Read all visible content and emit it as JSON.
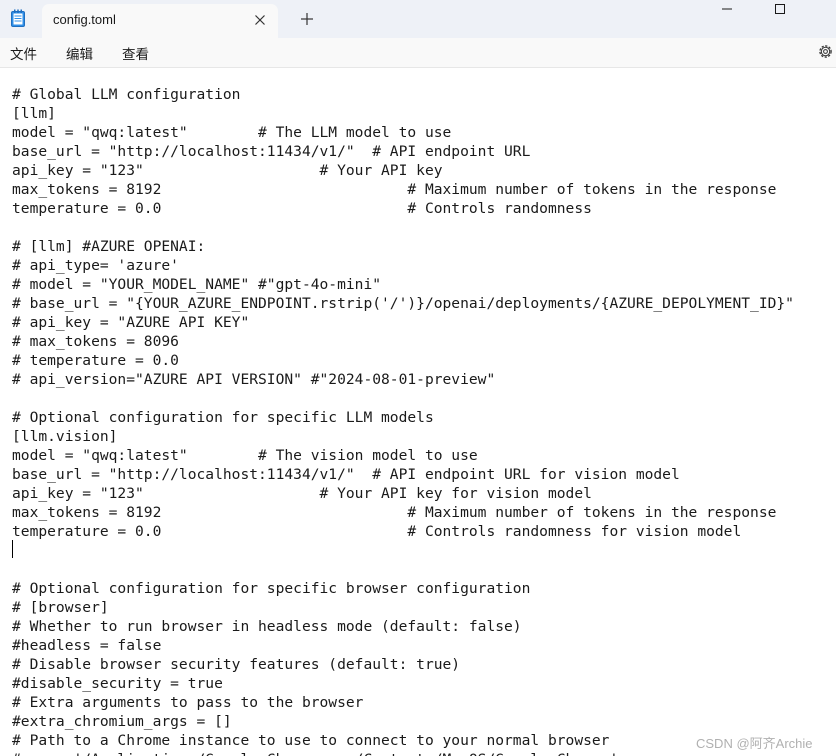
{
  "window": {
    "tab_title": "config.toml"
  },
  "menu": {
    "file": "文件",
    "edit": "编辑",
    "view": "查看"
  },
  "icons": {
    "app": "notepad-icon",
    "close_tab": "close-icon",
    "new_tab": "plus-icon",
    "minimize": "minimize-icon",
    "maximize": "maximize-icon",
    "settings": "gear-icon"
  },
  "editor": {
    "lines": [
      "# Global LLM configuration",
      "[llm]",
      "model = \"qwq:latest\"        # The LLM model to use",
      "base_url = \"http://localhost:11434/v1/\"  # API endpoint URL",
      "api_key = \"123\"                    # Your API key",
      "max_tokens = 8192                            # Maximum number of tokens in the response",
      "temperature = 0.0                            # Controls randomness",
      "",
      "# [llm] #AZURE OPENAI:",
      "# api_type= 'azure'",
      "# model = \"YOUR_MODEL_NAME\" #\"gpt-4o-mini\"",
      "# base_url = \"{YOUR_AZURE_ENDPOINT.rstrip('/')}/openai/deployments/{AZURE_DEPOLYMENT_ID}\"",
      "# api_key = \"AZURE API KEY\"",
      "# max_tokens = 8096",
      "# temperature = 0.0",
      "# api_version=\"AZURE API VERSION\" #\"2024-08-01-preview\"",
      "",
      "# Optional configuration for specific LLM models",
      "[llm.vision]",
      "model = \"qwq:latest\"        # The vision model to use",
      "base_url = \"http://localhost:11434/v1/\"  # API endpoint URL for vision model",
      "api_key = \"123\"                    # Your API key for vision model",
      "max_tokens = 8192                            # Maximum number of tokens in the response",
      "temperature = 0.0                            # Controls randomness for vision model",
      "",
      "",
      "# Optional configuration for specific browser configuration",
      "# [browser]",
      "# Whether to run browser in headless mode (default: false)",
      "#headless = false",
      "# Disable browser security features (default: true)",
      "#disable_security = true",
      "# Extra arguments to pass to the browser",
      "#extra_chromium_args = []",
      "# Path to a Chrome instance to use to connect to your normal browser",
      "# e.g. '/Applications/Google Chrome.app/Contents/MacOS/Google Chrome'"
    ]
  },
  "watermark": "CSDN @阿齐Archie"
}
